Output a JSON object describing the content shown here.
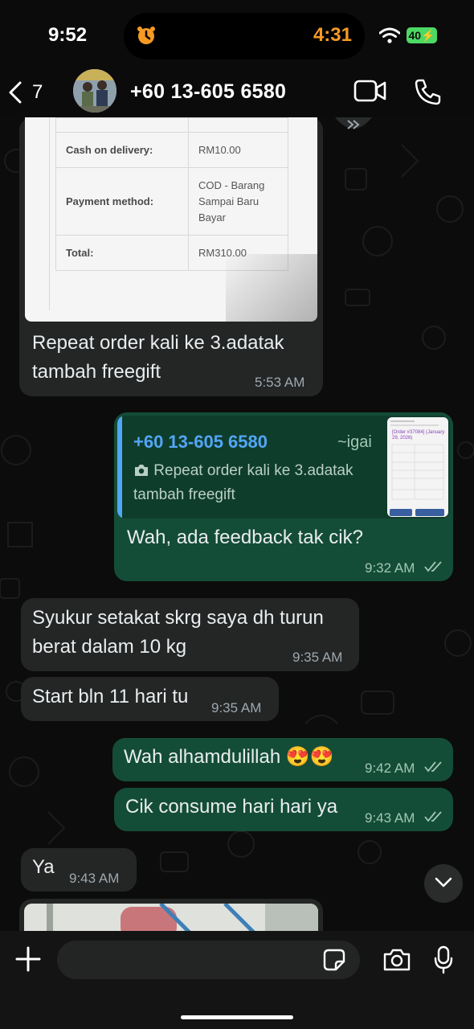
{
  "status_bar": {
    "time": "9:52",
    "timer": "4:31",
    "battery_label": "40"
  },
  "header": {
    "back_count": "7",
    "contact_name": "+60 13-605 6580"
  },
  "order_image": {
    "rows": [
      {
        "label": "Cash on delivery:",
        "value": "RM10.00"
      },
      {
        "label": "Payment method:",
        "value": "COD - Barang\nSampai Baru\nBayar"
      },
      {
        "label": "Total:",
        "value": "RM310.00"
      }
    ]
  },
  "messages": [
    {
      "id": "m1",
      "text": "Repeat order kali ke 3.adatak\ntambah freegift",
      "time": "5:53 AM"
    },
    {
      "id": "m2",
      "quote_author": "+60 13-605 6580",
      "quote_push": "~igai",
      "quote_text": "Repeat order kali ke 3.adatak tambah freegift",
      "text": "Wah, ada feedback tak cik?",
      "time": "9:32 AM"
    },
    {
      "id": "m3",
      "text": "Syukur setakat skrg saya dh turun\nberat dalam 10 kg",
      "time": "9:35 AM"
    },
    {
      "id": "m4",
      "text": "Start bln 11 hari tu",
      "time": "9:35 AM"
    },
    {
      "id": "m5",
      "text": "Wah alhamdulillah 😍😍",
      "time": "9:42 AM"
    },
    {
      "id": "m6",
      "text": "Cik consume hari hari ya",
      "time": "9:43 AM"
    },
    {
      "id": "m7",
      "text": "Ya",
      "time": "9:43 AM"
    }
  ],
  "quote_thumb": {
    "title": "[Order #37084] (January 29, 2026)"
  },
  "composer": {
    "placeholder": ""
  }
}
